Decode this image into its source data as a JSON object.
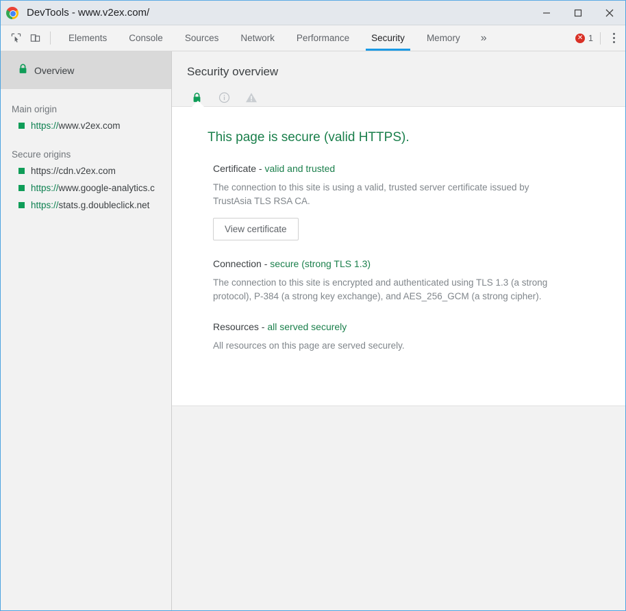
{
  "window": {
    "title": "DevTools - www.v2ex.com/",
    "logo_icon": "chrome-logo",
    "controls": {
      "minimize": "minimize-icon",
      "maximize": "maximize-icon",
      "close": "close-icon"
    }
  },
  "toolbar": {
    "inspect_icon": "inspect-element-icon",
    "device_icon": "device-toolbar-icon",
    "tabs": [
      {
        "label": "Elements",
        "active": false
      },
      {
        "label": "Console",
        "active": false
      },
      {
        "label": "Sources",
        "active": false
      },
      {
        "label": "Network",
        "active": false
      },
      {
        "label": "Performance",
        "active": false
      },
      {
        "label": "Security",
        "active": true
      },
      {
        "label": "Memory",
        "active": false
      }
    ],
    "more_tabs_label": "»",
    "error_badge": {
      "icon": "error-icon",
      "count": "1",
      "color": "#d93025"
    },
    "kebab_label": "more-options-icon",
    "active_tab_color": "#1a9ae5"
  },
  "sidebar": {
    "overview": {
      "label": "Overview",
      "icon": "lock-icon",
      "selected": true
    },
    "sections": [
      {
        "heading": "Main origin",
        "origins": [
          {
            "scheme": "https://",
            "host": "www.v2ex.com",
            "secure": true,
            "scheme_green": true
          }
        ]
      },
      {
        "heading": "Secure origins",
        "origins": [
          {
            "scheme": "https://",
            "host": "cdn.v2ex.com",
            "secure": true,
            "scheme_green": false
          },
          {
            "scheme": "https://",
            "host": "www.google-analytics.c",
            "secure": true,
            "scheme_green": true
          },
          {
            "scheme": "https://",
            "host": "stats.g.doubleclick.net",
            "secure": true,
            "scheme_green": true
          }
        ]
      }
    ]
  },
  "main": {
    "title": "Security overview",
    "filter_icons": [
      {
        "name": "lock-icon",
        "active": true
      },
      {
        "name": "info-icon",
        "active": false
      },
      {
        "name": "warning-icon",
        "active": false
      }
    ],
    "summary": "This page is secure (valid HTTPS).",
    "explanations": [
      {
        "title": "Certificate - ",
        "state": "valid and trusted",
        "description": "The connection to this site is using a valid, trusted server certificate issued by TrustAsia TLS RSA CA.",
        "button": "View certificate"
      },
      {
        "title": "Connection - ",
        "state": "secure (strong TLS 1.3)",
        "description": "The connection to this site is encrypted and authenticated using TLS 1.3 (a strong protocol), P-384 (a strong key exchange), and AES_256_GCM (a strong cipher).",
        "button": null
      },
      {
        "title": "Resources - ",
        "state": "all served securely",
        "description": "All resources on this page are served securely.",
        "button": null
      }
    ]
  },
  "colors": {
    "secure_green": "#1a7f4b",
    "accent_blue": "#1a9ae5",
    "error_red": "#d93025"
  }
}
